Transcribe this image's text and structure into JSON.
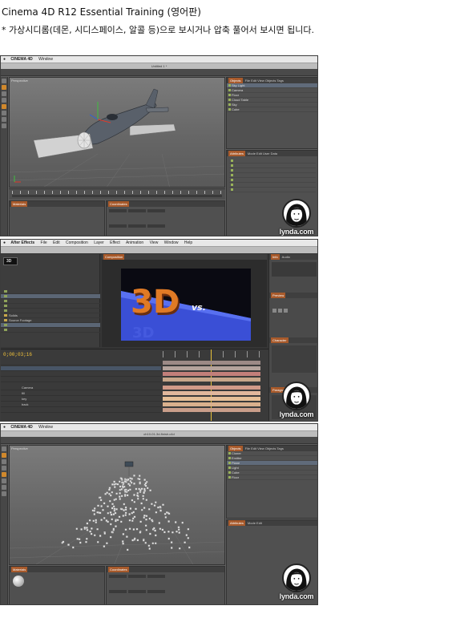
{
  "header": {
    "title": "Cinema 4D R12 Essential Training (영어판)",
    "subtitle": "* 가상시디롬(데몬, 시디스페이스, 알콜 등)으로 보시거나 압축 풀어서 보시면 됩니다."
  },
  "colors": {
    "accent_orange": "#d8922f",
    "ae_timecode": "#f0c13a",
    "panel_gray": "#505050"
  },
  "screens": [
    {
      "menubar": {
        "app": "CINEMA 4D",
        "items": [
          "Window"
        ]
      },
      "window_title": "Untitled 1 *",
      "viewport_label": "Perspective",
      "objects": [
        "Sky Light",
        "Camera",
        "Floor",
        "Cloud Table",
        "Sky",
        "Cube"
      ],
      "watermark": "lynda.com"
    },
    {
      "menubar": {
        "app": "After Effects",
        "items": [
          "File",
          "Edit",
          "Composition",
          "Layer",
          "Effect",
          "Animation",
          "View",
          "Window",
          "Help"
        ]
      },
      "comp_text": "3D",
      "comp_text2": "vs.",
      "timecode": "0;00;03;16",
      "project_items": [
        "Solids",
        "Source Footage"
      ],
      "layers": [
        "Camera",
        "fill",
        "key",
        "back"
      ],
      "watermark": "lynda.com"
    },
    {
      "menubar": {
        "app": "CINEMA 4D",
        "items": [
          "Window"
        ]
      },
      "window_title": "ch10-01-3d-finish.c4d",
      "viewport_label": "Perspective",
      "objects": [
        "Cloner",
        "Emitter",
        "Plane",
        "Light",
        "Cube",
        "Floor"
      ],
      "watermark": "lynda.com"
    }
  ]
}
